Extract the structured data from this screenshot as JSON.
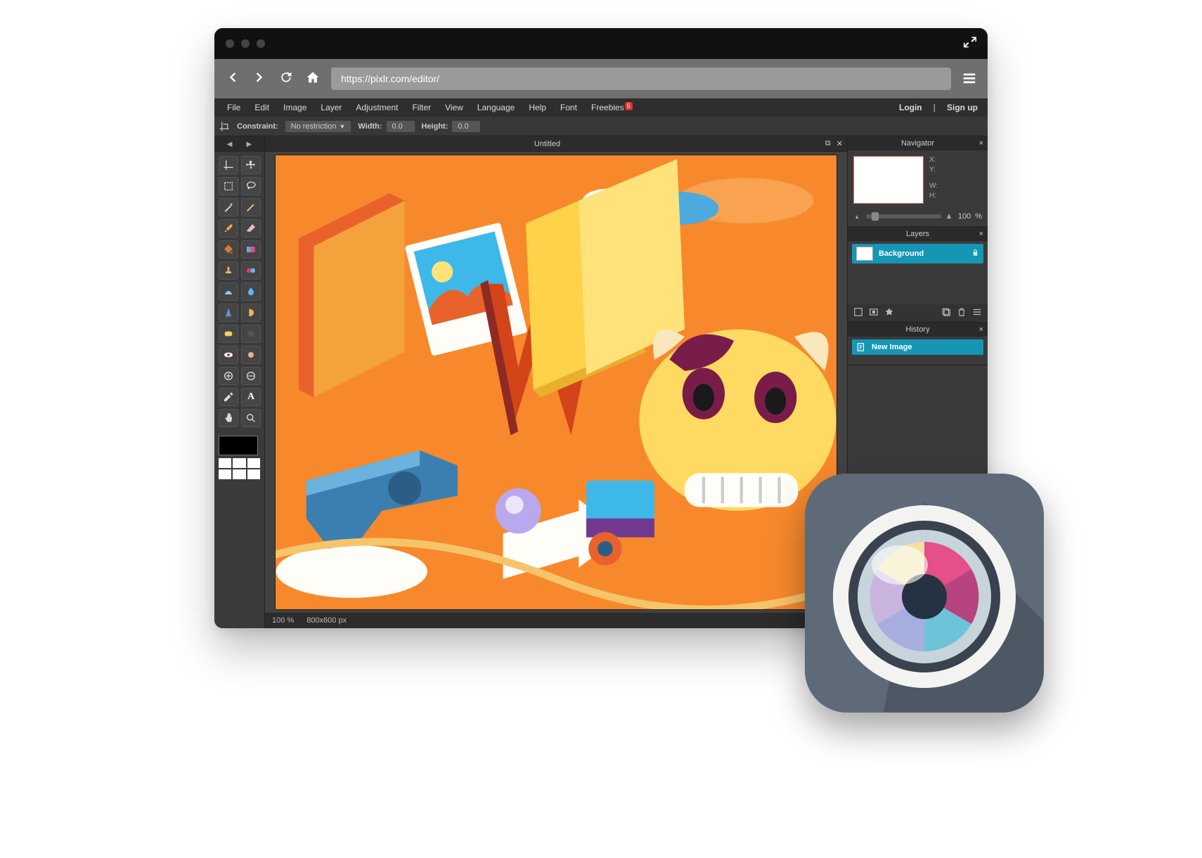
{
  "browser": {
    "url": "https://pixlr.com/editor/"
  },
  "menu": {
    "items": [
      "File",
      "Edit",
      "Image",
      "Layer",
      "Adjustment",
      "Filter",
      "View",
      "Language",
      "Help",
      "Font",
      "Freebies"
    ],
    "freebies_badge": "5",
    "login": "Login",
    "signup": "Sign up"
  },
  "subbar": {
    "constraint_label": "Constraint:",
    "constraint_value": "No restriction",
    "width_label": "Width:",
    "width_value": "0.0",
    "height_label": "Height:",
    "height_value": "0.0"
  },
  "document": {
    "title": "Untitled"
  },
  "status": {
    "zoom": "100",
    "zoom_unit": "%",
    "dimensions": "800x600 px"
  },
  "panels": {
    "navigator": {
      "title": "Navigator",
      "x_label": "X:",
      "y_label": "Y:",
      "w_label": "W:",
      "h_label": "H:",
      "zoom": "100",
      "zoom_unit": "%"
    },
    "layers": {
      "title": "Layers",
      "items": [
        {
          "name": "Background"
        }
      ]
    },
    "history": {
      "title": "History",
      "items": [
        {
          "name": "New Image"
        }
      ]
    }
  },
  "toolbox": {
    "tools": [
      "crop",
      "move",
      "marquee",
      "lasso",
      "wand",
      "pencil",
      "brush",
      "eraser",
      "paint-bucket",
      "gradient",
      "clone-stamp",
      "color-replace",
      "draw",
      "blur",
      "sharpen",
      "smudge",
      "sponge",
      "dodge",
      "red-eye",
      "spot-heal",
      "bloat",
      "pinch",
      "color-picker",
      "type",
      "hand",
      "zoom"
    ]
  }
}
